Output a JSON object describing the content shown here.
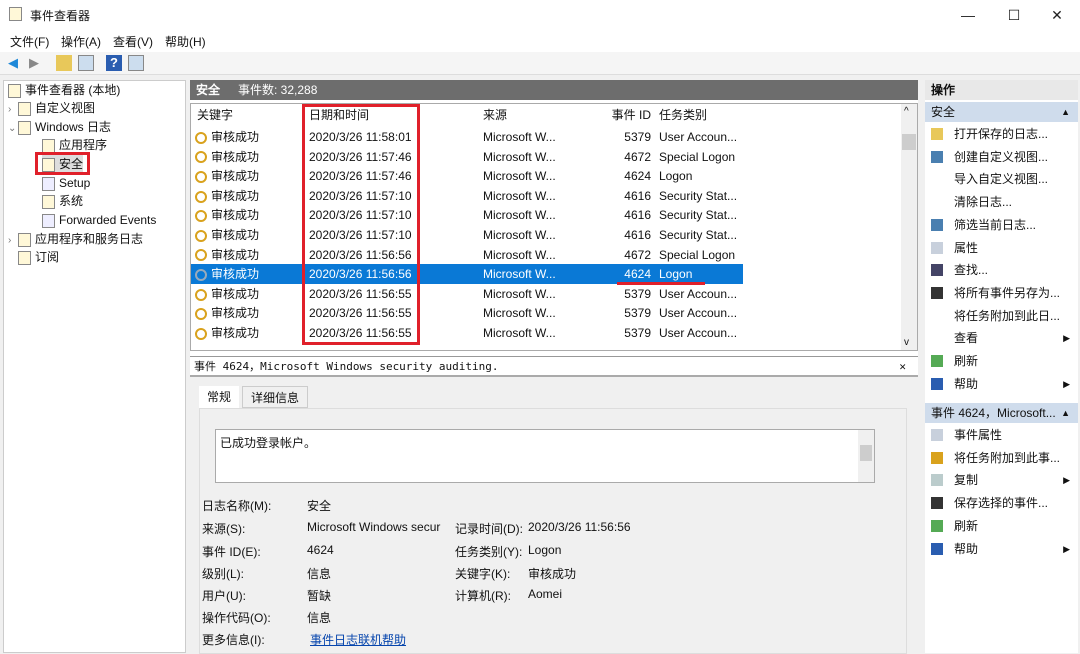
{
  "window": {
    "title": "事件查看器",
    "controls": [
      "—",
      "☐",
      "✕"
    ]
  },
  "menu": [
    "文件(F)",
    "操作(A)",
    "查看(V)",
    "帮助(H)"
  ],
  "toolbar": {
    "icons": [
      "back-arrow-icon",
      "forward-arrow-icon",
      "folder-up-icon",
      "show-hide-tree-icon",
      "help-icon",
      "show-action-pane-icon"
    ]
  },
  "tree": {
    "root": "事件查看器 (本地)",
    "items": [
      {
        "label": "自定义视图",
        "level": 1,
        "caret": "›"
      },
      {
        "label": "Windows 日志",
        "level": 1,
        "caret": "⌄"
      },
      {
        "label": "应用程序",
        "level": 2
      },
      {
        "label": "安全",
        "level": 2,
        "selected": true
      },
      {
        "label": "Setup",
        "level": 2
      },
      {
        "label": "系统",
        "level": 2
      },
      {
        "label": "Forwarded Events",
        "level": 2
      },
      {
        "label": "应用程序和服务日志",
        "level": 1,
        "caret": "›"
      },
      {
        "label": "订阅",
        "level": 1
      }
    ]
  },
  "list": {
    "log_name": "安全",
    "count_label": "事件数: 32,288",
    "columns": [
      "关键字",
      "日期和时间",
      "来源",
      "事件 ID",
      "任务类别"
    ],
    "rows": [
      [
        "审核成功",
        "2020/3/26 11:58:01",
        "Microsoft W...",
        "5379",
        "User Accoun..."
      ],
      [
        "审核成功",
        "2020/3/26 11:57:46",
        "Microsoft W...",
        "4672",
        "Special Logon"
      ],
      [
        "审核成功",
        "2020/3/26 11:57:46",
        "Microsoft W...",
        "4624",
        "Logon"
      ],
      [
        "审核成功",
        "2020/3/26 11:57:10",
        "Microsoft W...",
        "4616",
        "Security Stat..."
      ],
      [
        "审核成功",
        "2020/3/26 11:57:10",
        "Microsoft W...",
        "4616",
        "Security Stat..."
      ],
      [
        "审核成功",
        "2020/3/26 11:57:10",
        "Microsoft W...",
        "4616",
        "Security Stat..."
      ],
      [
        "审核成功",
        "2020/3/26 11:56:56",
        "Microsoft W...",
        "4672",
        "Special Logon"
      ],
      [
        "审核成功",
        "2020/3/26 11:56:56",
        "Microsoft W...",
        "4624",
        "Logon"
      ],
      [
        "审核成功",
        "2020/3/26 11:56:55",
        "Microsoft W...",
        "5379",
        "User Accoun..."
      ],
      [
        "审核成功",
        "2020/3/26 11:56:55",
        "Microsoft W...",
        "5379",
        "User Accoun..."
      ],
      [
        "审核成功",
        "2020/3/26 11:56:55",
        "Microsoft W...",
        "5379",
        "User Accoun..."
      ]
    ],
    "selected_row": 7
  },
  "detail": {
    "title": "事件 4624，Microsoft Windows security auditing.",
    "close": "✕",
    "tabs": [
      "常规",
      "详细信息"
    ],
    "message": "已成功登录帐户。",
    "fields": {
      "log_name_label": "日志名称(M):",
      "log_name": "安全",
      "source_label": "来源(S):",
      "source": "Microsoft Windows secur",
      "logged_label": "记录时间(D):",
      "logged": "2020/3/26 11:56:56",
      "event_id_label": "事件 ID(E):",
      "event_id": "4624",
      "task_label": "任务类别(Y):",
      "task": "Logon",
      "level_label": "级别(L):",
      "level": "信息",
      "keywords_label": "关键字(K):",
      "keywords": "审核成功",
      "user_label": "用户(U):",
      "user": "暂缺",
      "computer_label": "计算机(R):",
      "computer": "Aomei",
      "opcode_label": "操作代码(O):",
      "opcode": "信息",
      "more_label": "更多信息(I):",
      "more_link": "事件日志联机帮助"
    }
  },
  "actions": {
    "title": "操作",
    "section1": {
      "title": "安全",
      "items": [
        {
          "label": "打开保存的日志...",
          "icon": "open-folder-icon"
        },
        {
          "label": "创建自定义视图...",
          "icon": "filter-icon"
        },
        {
          "label": "导入自定义视图...",
          "icon": ""
        },
        {
          "label": "清除日志...",
          "icon": ""
        },
        {
          "label": "筛选当前日志...",
          "icon": "filter-icon"
        },
        {
          "label": "属性",
          "icon": "properties-icon"
        },
        {
          "label": "查找...",
          "icon": "binoculars-icon"
        },
        {
          "label": "将所有事件另存为...",
          "icon": "save-icon"
        },
        {
          "label": "将任务附加到此日...",
          "icon": ""
        },
        {
          "label": "查看",
          "icon": "",
          "submenu": true
        },
        {
          "label": "刷新",
          "icon": "refresh-icon"
        },
        {
          "label": "帮助",
          "icon": "help-icon",
          "submenu": true
        }
      ]
    },
    "section2": {
      "title": "事件 4624，Microsoft...",
      "items": [
        {
          "label": "事件属性",
          "icon": "properties-icon"
        },
        {
          "label": "将任务附加到此事...",
          "icon": "task-icon"
        },
        {
          "label": "复制",
          "icon": "copy-icon",
          "submenu": true
        },
        {
          "label": "保存选择的事件...",
          "icon": "save-icon"
        },
        {
          "label": "刷新",
          "icon": "refresh-icon"
        },
        {
          "label": "帮助",
          "icon": "help-icon",
          "submenu": true
        }
      ]
    }
  },
  "colors": {
    "selection": "#0a79d6",
    "annotation": "#e0202a",
    "section_header": "#cfdcec",
    "list_header": "#6d6d6d"
  }
}
